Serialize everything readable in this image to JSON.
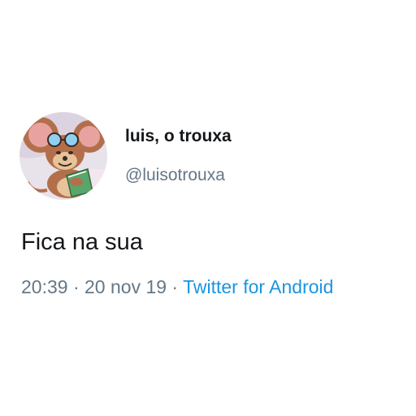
{
  "tweet": {
    "author": {
      "display_name": "luis, o trouxa",
      "handle": "@luisotrouxa",
      "avatar_icon": "cartoon-mouse-avatar"
    },
    "text": "Fica na sua",
    "meta": {
      "time": "20:39",
      "separator": " · ",
      "date": "20 nov 19",
      "source": "Twitter for Android"
    }
  },
  "colors": {
    "text_primary": "#14171a",
    "text_secondary": "#657786",
    "link": "#1b95e0",
    "background": "#ffffff"
  }
}
